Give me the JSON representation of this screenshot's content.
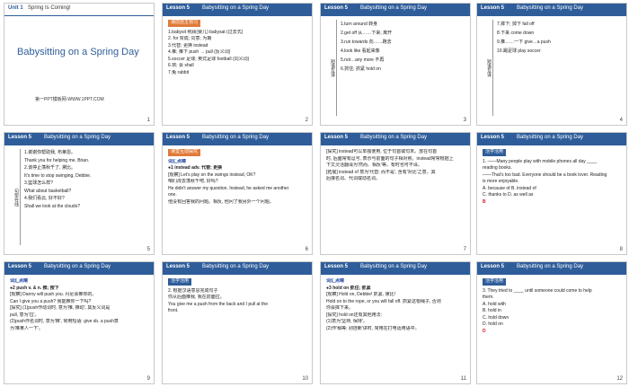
{
  "slides": [
    {
      "id": 1,
      "lesson": "Unit 1",
      "title": "Spring Is Coming!",
      "main": "Babysitting on a Spring Day",
      "sub": "第一PPT模板网-WWW.1PPT.COM",
      "num": "1"
    },
    {
      "id": 2,
      "lesson": "Lesson 5",
      "title": "Babysitting on a Spring Day",
      "tag": "课前自主预习",
      "lines": [
        "1.babysit 照顾(婴儿)  babysat (过去式)",
        "2. for 赞成; 同意; 为期",
        "3.代替; 更换 instead",
        "4.推; 推下 push → pull (反义词)",
        "5.soccer 足球; 英式足球 football (同义词)",
        "6.将; 会 shall",
        "7.兔 rabbit"
      ],
      "num": "2"
    },
    {
      "id": 3,
      "lesson": "Lesson 5",
      "title": "Babysitting on a Spring Day",
      "lc": "短语互译",
      "lines": [
        "1.turn around 转身",
        "2.get off 从……下来; 离开",
        "3.run towards 向……跑去",
        "4.look like 看起来像",
        "5.not…any more 不再",
        "6.抓住; 抓紧 hold on"
      ],
      "num": "3"
    },
    {
      "id": 4,
      "lesson": "Lesson 5",
      "title": "Babysitting on a Spring Day",
      "lc": "短语互译",
      "lines": [
        "7.摔下; 掉下 fall off",
        "8.下来 come down",
        "9.推……一下 give…a push",
        "10.踢足球 play soccer"
      ],
      "num": "4"
    },
    {
      "id": 5,
      "lesson": "Lesson 5",
      "title": "Babysitting on a Spring Day",
      "lc": "句型在线",
      "lines": [
        "1.谢谢你帮助我, 布莱恩。",
        "Thank you for helping me, Brian.",
        "2.该停止荡秋千了, 黛比。",
        "It's time to stop swinging, Debbie.",
        "3.篮球怎么样?",
        "What about basketball?",
        "4.我们看云, 好不好?",
        "Shall we look at the clouds?"
      ],
      "num": "5"
    },
    {
      "id": 6,
      "lesson": "Lesson 5",
      "title": "Babysitting on a Spring Day",
      "tag": "课堂互动探究",
      "lines": [
        "词汇点睛",
        "●1  instead adv. 代替; 更换",
        "[观察] Let's play on the swings instead, OK?",
        "咱们改去荡秋千吧, 好吗?",
        "He didn't answer my question. Instead, he asked me another",
        "one.",
        "他没有回答我的问题。相反, 他问了我另外一个问题。"
      ],
      "num": "6"
    },
    {
      "id": 7,
      "lesson": "Lesson 5",
      "title": "Babysitting on a Spring Day",
      "lines": [
        "[探究] instead可以单独使用, 位于句首或句末。放在句首",
        "时, 后面常有逗号, 表示与前面的句子相对照。instead常常根据上",
        "下文灵活翻译为'然而、相反'等。有时也可不译。",
        "",
        "[拓展] instead of 意为'代替; 而不是', 含有'对比'之意。其",
        "后接名词、代词或动名词。"
      ],
      "num": "7"
    },
    {
      "id": 8,
      "lesson": "Lesson 5",
      "title": "Babysitting on a Spring Day",
      "tag": "活学活用",
      "lines": [
        "1. ——Many people play with mobile phones all day ____",
        "reading books.",
        "——That's too bad. Everyone should be a book lover. Reading",
        "is more enjoyable.",
        "A. because of     B. instead of",
        "C. thanks to      D. as well as"
      ],
      "answer": "B",
      "num": "8"
    },
    {
      "id": 9,
      "lesson": "Lesson 5",
      "title": "Babysitting on a Spring Day",
      "lines": [
        "词汇点睛",
        "●2  push v. & n. 推; 按下",
        "[观察] Danny will push you. 丹尼会推你的。",
        "Can I give you a push? 我能推你一下吗?",
        "[探究] (1)push作动词时, 意为'推, 推动', 其反义词是",
        "pull, 意为'拉'。",
        "(2)push作名词时, 意为'推', 常用短语: give sb. a push意",
        "为'推某人一下'。"
      ],
      "num": "9"
    },
    {
      "id": 10,
      "lesson": "Lesson 5",
      "title": "Babysitting on a Spring Day",
      "tag": "活学活用",
      "lines": [
        "2. 根据汉语意思完成句子",
        "你从后面推我, 我在前面拉。",
        "You give me a push from the back and I pull at the",
        "front."
      ],
      "num": "10"
    },
    {
      "id": 11,
      "lesson": "Lesson 5",
      "title": "Babysitting on a Spring Day",
      "lines": [
        "词汇点睛",
        "●3  hold on 抓住; 抓紧",
        "[观察] Hold on, Debbie! 抓紧, 黛比!",
        "Hold on to the rope, or you will fall off. 抓紧这根绳子, 否则",
        "你会摔下来。",
        "[探究] hold on还有其他用法:",
        "(1)意为'坚持, 保持'。",
        "(2)作'稍等; 别挂断'讲时, 常用在打电话用语中。"
      ],
      "num": "11"
    },
    {
      "id": 12,
      "lesson": "Lesson 5",
      "title": "Babysitting on a Spring Day",
      "tag": "活学活用",
      "lines": [
        "3. They tried to ____ until someone could come to help",
        "them.",
        "A. hold with",
        "B. hold in",
        "C. hold down",
        "D. hold on"
      ],
      "answer": "D",
      "num": "12"
    }
  ]
}
